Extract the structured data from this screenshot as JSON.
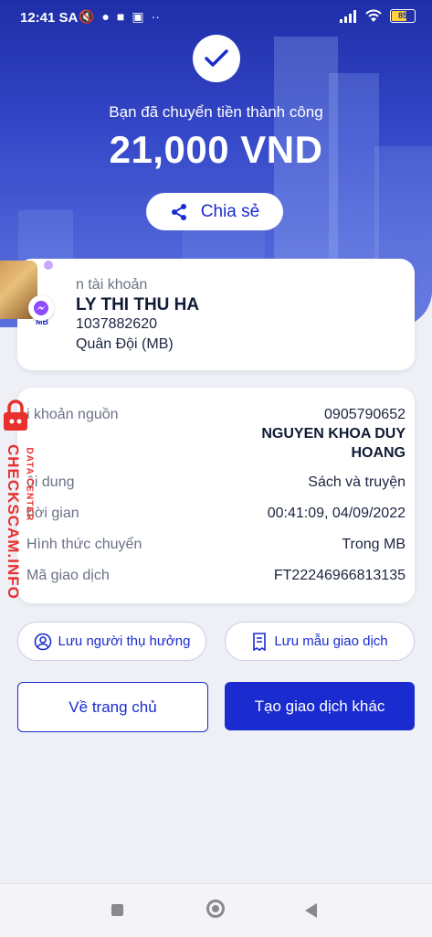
{
  "status_bar": {
    "time": "12:41 SA",
    "battery": "85"
  },
  "header": {
    "success_message": "Bạn đã chuyển tiền thành công",
    "amount": "21,000 VND",
    "share_label": "Chia sẻ"
  },
  "recipient": {
    "label": "n tài khoản",
    "name": "LY THI THU HA",
    "account_number": "1037882620",
    "bank": "Quân Đội (MB)",
    "bank_logo": "MB"
  },
  "details": {
    "rows": [
      {
        "label": "i khoản nguồn",
        "value": "0905790652"
      },
      {
        "label": "ội dung",
        "value": "Sách và truyện"
      },
      {
        "label": "hời gian",
        "value": "00:41:09, 04/09/2022"
      },
      {
        "label": "Hình thức chuyển",
        "value": "Trong MB"
      },
      {
        "label": "Mã giao dịch",
        "value": "FT22246966813135"
      }
    ],
    "source_name_line1": "NGUYEN KHOA DUY",
    "source_name_line2": "HOANG"
  },
  "actions": {
    "save_beneficiary": "Lưu người thụ hưởng",
    "save_template": "Lưu mẫu giao dịch",
    "home": "Về trang chủ",
    "new_transaction": "Tạo giao dịch khác"
  },
  "watermark": {
    "main": "CHECKSCAM.INFO",
    "sub": "DATA CENTER"
  },
  "colors": {
    "accent": "#1a2bd0",
    "watermark": "#e8302e"
  }
}
